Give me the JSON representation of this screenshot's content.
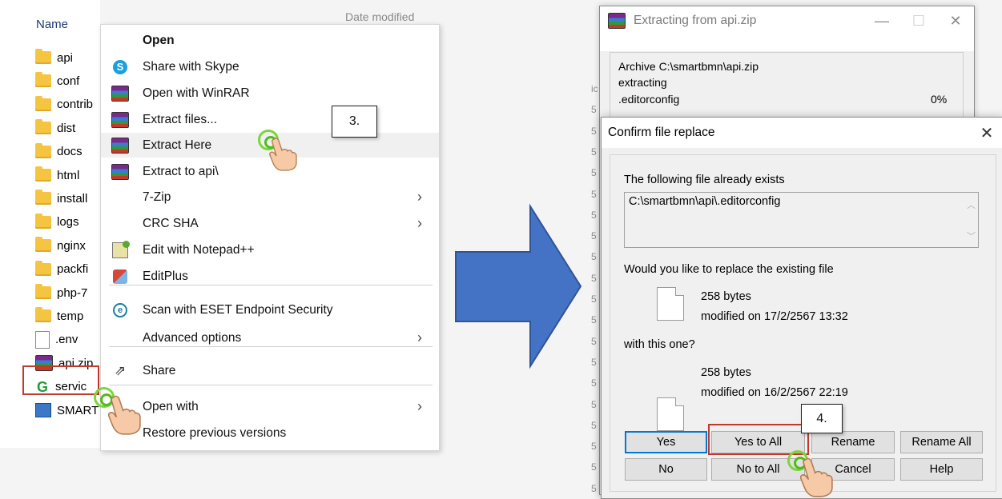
{
  "explorer": {
    "column_name": "Name",
    "column_date": "Date modified",
    "files": [
      {
        "name": "api",
        "type": "folder"
      },
      {
        "name": "conf",
        "type": "folder"
      },
      {
        "name": "contrib",
        "type": "folder"
      },
      {
        "name": "dist",
        "type": "folder"
      },
      {
        "name": "docs",
        "type": "folder"
      },
      {
        "name": "html",
        "type": "folder"
      },
      {
        "name": "install",
        "type": "folder"
      },
      {
        "name": "logs",
        "type": "folder"
      },
      {
        "name": "nginx",
        "type": "folder"
      },
      {
        "name": "packfi",
        "type": "folder"
      },
      {
        "name": "php-7",
        "type": "folder"
      },
      {
        "name": "temp",
        "type": "folder"
      },
      {
        "name": ".env",
        "type": "file"
      },
      {
        "name": "api.zip",
        "type": "archive"
      },
      {
        "name": "servic",
        "type": "app"
      },
      {
        "name": "SMART",
        "type": "shortcut"
      }
    ]
  },
  "context_menu": {
    "items": [
      {
        "label": "Open",
        "icon": "none"
      },
      {
        "label": "Share with Skype",
        "icon": "skype-icon"
      },
      {
        "label": "Open with WinRAR",
        "icon": "winrar-icon"
      },
      {
        "label": "Extract files...",
        "icon": "winrar-icon"
      },
      {
        "label": "Extract Here",
        "icon": "winrar-icon"
      },
      {
        "label": "Extract to api\\",
        "icon": "winrar-icon"
      },
      {
        "label": "7-Zip",
        "icon": "none"
      },
      {
        "label": "CRC SHA",
        "icon": "none"
      },
      {
        "label": "Edit with Notepad++",
        "icon": "notepadpp-icon"
      },
      {
        "label": "EditPlus",
        "icon": "editplus-icon"
      },
      {
        "label": "Scan with ESET Endpoint Security",
        "icon": "eset-icon"
      },
      {
        "label": "Advanced options",
        "icon": "none"
      },
      {
        "label": "Share",
        "icon": "share-icon"
      },
      {
        "label": "Open with",
        "icon": "none"
      },
      {
        "label": "Restore previous versions",
        "icon": "none"
      }
    ]
  },
  "steps": {
    "step3": "3.",
    "step4": "4."
  },
  "extract_window": {
    "title": "Extracting from api.zip",
    "archive_line": "Archive C:\\smartbmn\\api.zip",
    "status": "extracting",
    "current_file": ".editorconfig",
    "percent": "0%",
    "progress_fraction": 0,
    "side_chars": [
      "ic",
      "5",
      "5",
      "5",
      "5",
      "5",
      "5",
      "5",
      "5",
      "5",
      "5",
      "5",
      "5",
      "5",
      "5",
      "5",
      "5",
      "5",
      "5",
      "5"
    ]
  },
  "confirm_dialog": {
    "title": "Confirm file replace",
    "exists_text": "The following file already exists",
    "path": "C:\\smartbmn\\api\\.editorconfig",
    "question": "Would you like to replace the existing file",
    "existing_size": "258 bytes",
    "existing_modified": "modified on 17/2/2567 13:32",
    "with_text": "with this one?",
    "new_size": "258 bytes",
    "new_modified": "modified on 16/2/2567 22:19",
    "buttons": {
      "yes": "Yes",
      "yes_to_all": "Yes to All",
      "rename": "Rename",
      "rename_all": "Rename All",
      "no": "No",
      "no_to_all": "No to All",
      "cancel": "Cancel",
      "help": "Help"
    }
  },
  "colors": {
    "highlight": "#c0392b",
    "arrow": "#4472c4",
    "click_ring": "#7cd53a"
  }
}
